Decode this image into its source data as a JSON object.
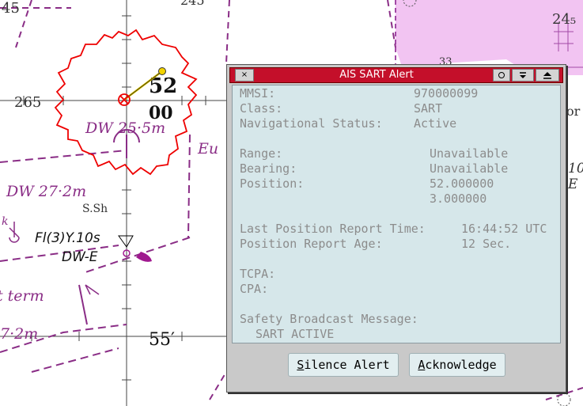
{
  "chart": {
    "labels": {
      "top_left": "45",
      "top_center": "245",
      "top_right": "24₅",
      "left_265": "265",
      "minute_52": "52",
      "minute_00": "00",
      "minute_55": "55′",
      "dw_25": "DW 25·5m",
      "eu": "Eu",
      "dw_27": "DW 27·2m",
      "s_sh": "S.Sh",
      "k": "k",
      "light": "Fl(3)Y.10s",
      "dw_e": "DW-E",
      "term": "t term",
      "dw_72": "7·2m",
      "right_10": "10",
      "right_e": "E",
      "right_or": "or",
      "small_33": "33"
    }
  },
  "dialog": {
    "title": "AIS SART Alert",
    "close_label": "×",
    "fields": {
      "mmsi_label": "MMSI:",
      "mmsi_value": "970000099",
      "class_label": "Class:",
      "class_value": "SART",
      "nav_label": "Navigational Status:",
      "nav_value": "Active",
      "range_label": "Range:",
      "range_value": "Unavailable",
      "bearing_label": "Bearing:",
      "bearing_value": "Unavailable",
      "position_label": "Position:",
      "position_lat": "52.000000",
      "position_lon": "3.000000",
      "last_report_label": "Last Position Report Time:",
      "last_report_value": "16:44:52 UTC",
      "report_age_label": "Position Report Age:",
      "report_age_value": "12 Sec.",
      "tcpa_label": "TCPA:",
      "cpa_label": "CPA:",
      "safety_label": "Safety Broadcast Message:",
      "safety_value": "SART ACTIVE"
    },
    "buttons": {
      "silence_label": "Silence Alert",
      "acknowledge_label": "Acknowledge"
    }
  }
}
